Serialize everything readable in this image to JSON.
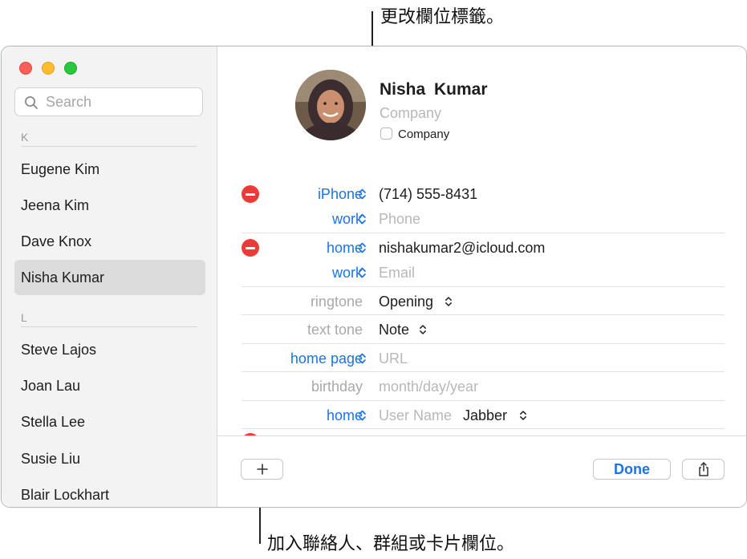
{
  "callouts": {
    "top": "更改欄位標籤。",
    "bottom": "加入聯絡人、群組或卡片欄位。"
  },
  "sidebar": {
    "search_placeholder": "Search",
    "sections": [
      {
        "header": "K",
        "contacts": [
          "Eugene Kim",
          "Jeena Kim",
          "Dave Knox",
          "Nisha Kumar"
        ]
      },
      {
        "header": "L",
        "contacts": [
          "Steve Lajos",
          "Joan Lau",
          "Stella Lee",
          "Susie Liu",
          "Blair Lockhart"
        ]
      }
    ],
    "selected_contact": "Nisha Kumar"
  },
  "card": {
    "first_name": "Nisha",
    "last_name": "Kumar",
    "company_placeholder": "Company",
    "company_checkbox_label": "Company",
    "company_checkbox_checked": false,
    "fields": [
      {
        "label": "iPhone",
        "value": "(714) 555-8431"
      },
      {
        "label": "work",
        "placeholder": "Phone"
      },
      {
        "label": "home",
        "value": "nishakumar2@icloud.com"
      },
      {
        "label": "work",
        "placeholder": "Email"
      },
      {
        "label": "ringtone",
        "value": "Opening"
      },
      {
        "label": "text tone",
        "value": "Note"
      },
      {
        "label": "home page",
        "placeholder": "URL"
      },
      {
        "label": "birthday",
        "placeholder": "month/day/year"
      },
      {
        "label": "home",
        "placeholder": "User Name",
        "service": "Jabber"
      }
    ]
  },
  "buttons": {
    "add_label": "+",
    "done_label": "Done",
    "share_icon": "share-icon"
  },
  "colors": {
    "accent": "#1a74e8",
    "remove": "#ec3b36",
    "selection": "#dcdcdc"
  }
}
